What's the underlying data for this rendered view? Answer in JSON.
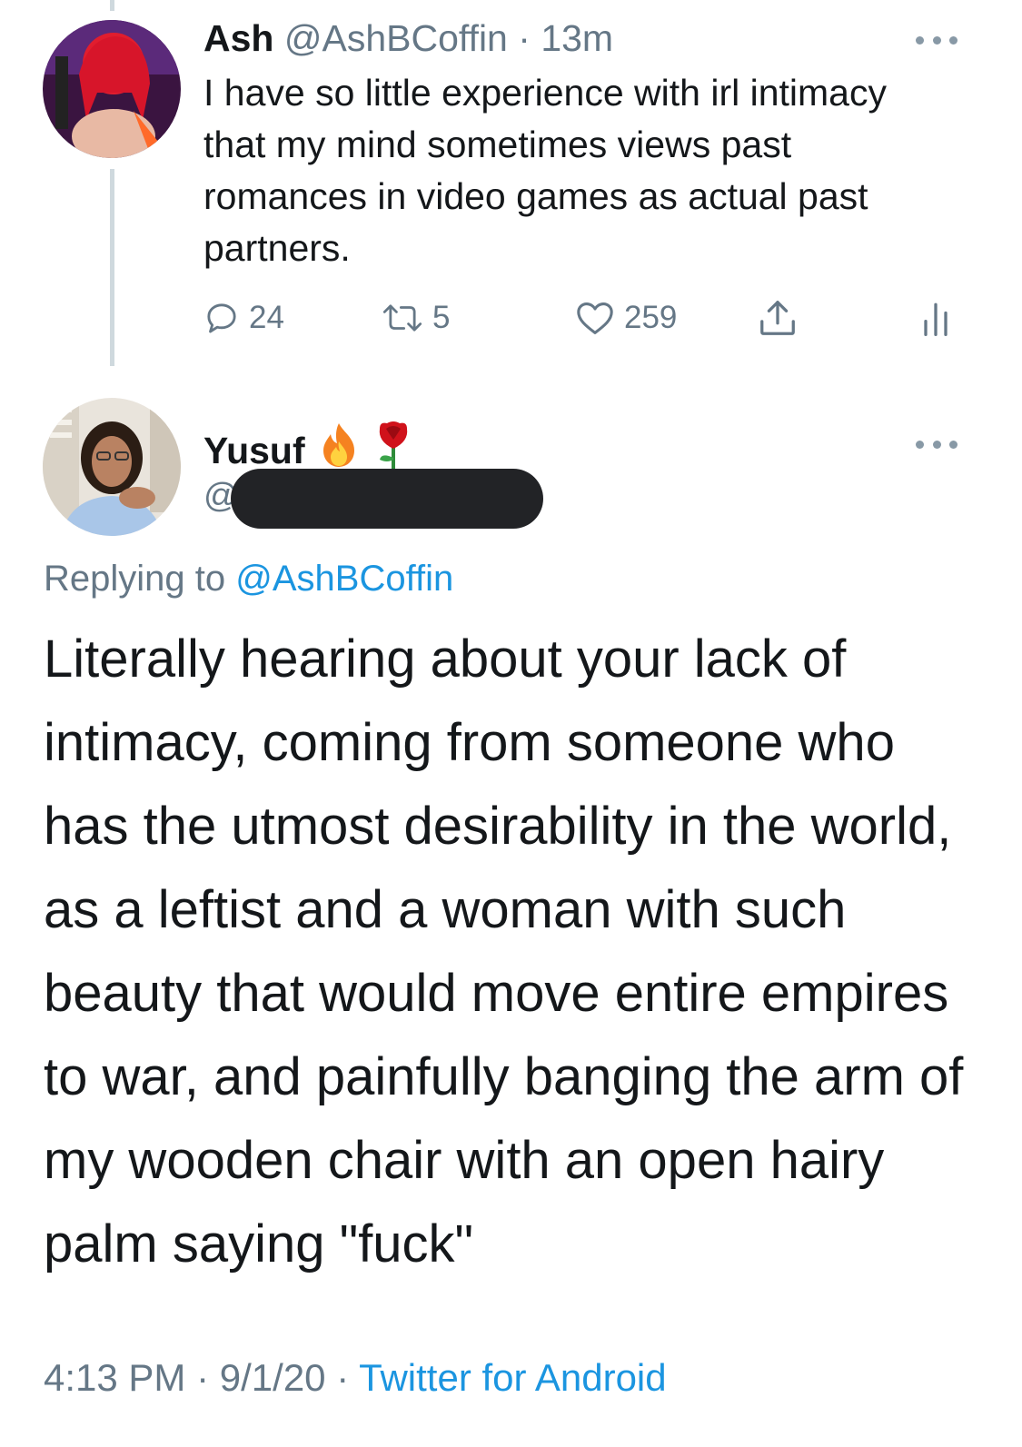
{
  "original_tweet": {
    "author_name": "Ash",
    "author_handle": "@AshBCoffin",
    "separator": "·",
    "time_ago": "13m",
    "text": "I have so little experience with irl intimacy that my mind sometimes views past romances in video games as actual past partners.",
    "actions": {
      "reply_count": "24",
      "retweet_count": "5",
      "like_count": "259"
    },
    "icons": [
      "reply-icon",
      "retweet-icon",
      "like-icon",
      "share-icon",
      "analytics-icon",
      "more-icon"
    ]
  },
  "reply_tweet": {
    "author_name": "Yusuf",
    "name_emojis": [
      "fire-emoji",
      "rose-emoji"
    ],
    "handle_visible": "@",
    "handle_redacted": true,
    "replying_prefix": "Replying to",
    "replying_handle": "@AshBCoffin",
    "text": "Literally hearing about your lack of intimacy, coming from someone who has the utmost desirability in the world, as a leftist and a woman with such beauty that would move entire empires to war, and painfully banging the arm of my wooden chair with an open hairy palm saying \"fuck\"",
    "time": "4:13 PM",
    "separator": "·",
    "date": "9/1/20",
    "source": "Twitter for Android"
  },
  "colors": {
    "text_primary": "#14171a",
    "text_secondary": "#657786",
    "link": "#1b95e0",
    "thread_line": "#cfd9de",
    "redaction": "#222326"
  }
}
